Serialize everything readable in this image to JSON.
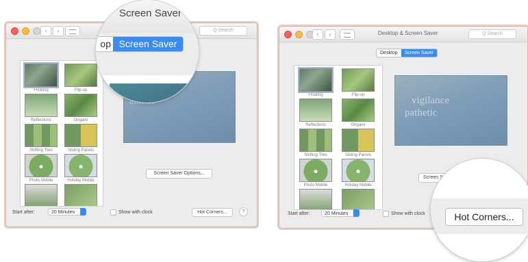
{
  "left": {
    "search_placeholder": "Q Search",
    "seg_partial": "op",
    "seg_selected": "Screen Saver",
    "mag_title": "Screen Saver",
    "preview_line1": "ance",
    "preview_line2": "athetic",
    "items": [
      {
        "label": "Floating"
      },
      {
        "label": "Flip-up"
      },
      {
        "label": "Reflections"
      },
      {
        "label": "Origami"
      },
      {
        "label": "Shifting Tiles"
      },
      {
        "label": "Sliding Panels"
      },
      {
        "label": "Photo Mobile"
      },
      {
        "label": "Holiday Mobile"
      }
    ],
    "options_button": "Screen Saver Options...",
    "start_after_label": "Start after:",
    "start_after_value": "20 Minutes",
    "show_clock_label": "Show with clock",
    "hot_corners": "Hot Corners...",
    "help": "?"
  },
  "right": {
    "window_title": "Desktop & Screen Saver",
    "search_placeholder": "Q Search",
    "tab_desktop": "Desktop",
    "tab_screensaver": "Screen Saver",
    "preview_line1": "vigilance",
    "preview_line2": "pathetic",
    "items": [
      {
        "label": "Floating"
      },
      {
        "label": "Flip-up"
      },
      {
        "label": "Reflections"
      },
      {
        "label": "Origami"
      },
      {
        "label": "Shifting Tiles"
      },
      {
        "label": "Sliding Panels"
      },
      {
        "label": "Photo Mobile"
      },
      {
        "label": "Holiday Mobile"
      }
    ],
    "options_button_partial": "Screen S",
    "start_after_label": "Start after:",
    "start_after_value": "20 Minutes",
    "show_clock_label": "Show with clock",
    "mag_hot_corners": "Hot Corners..."
  },
  "colors": {
    "accent": "#3b8cf0",
    "window_border": "#d9b7b0"
  }
}
